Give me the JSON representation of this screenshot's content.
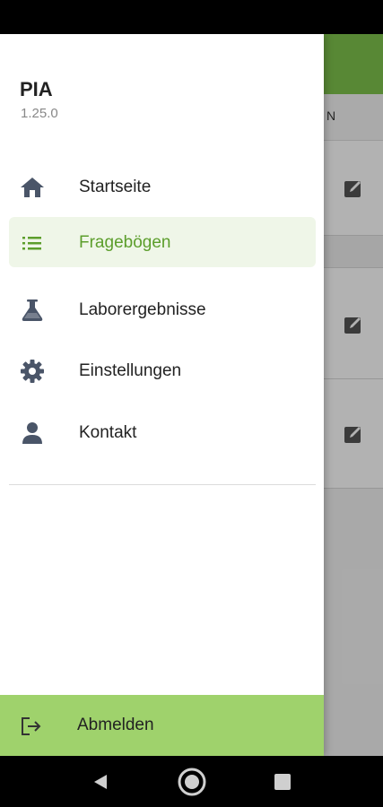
{
  "drawer": {
    "app_name": "PIA",
    "version": "1.25.0",
    "menu": [
      {
        "label": "Startseite",
        "icon": "home-icon",
        "active": false
      },
      {
        "label": "Fragebögen",
        "icon": "list-icon",
        "active": true
      },
      {
        "label": "Laborergebnisse",
        "icon": "flask-icon",
        "active": false
      },
      {
        "label": "Einstellungen",
        "icon": "gear-icon",
        "active": false
      },
      {
        "label": "Kontakt",
        "icon": "person-icon",
        "active": false
      }
    ],
    "logout_label": "Abmelden",
    "logout_icon": "logout-icon"
  },
  "background": {
    "header_partial_text": "N",
    "row_icon": "edit-icon"
  },
  "colors": {
    "accent": "#7fc34d",
    "active_text": "#5c9e2c",
    "active_bg": "#eff6e8",
    "logout_bg": "#9fd26c",
    "icon": "#4a5568"
  }
}
